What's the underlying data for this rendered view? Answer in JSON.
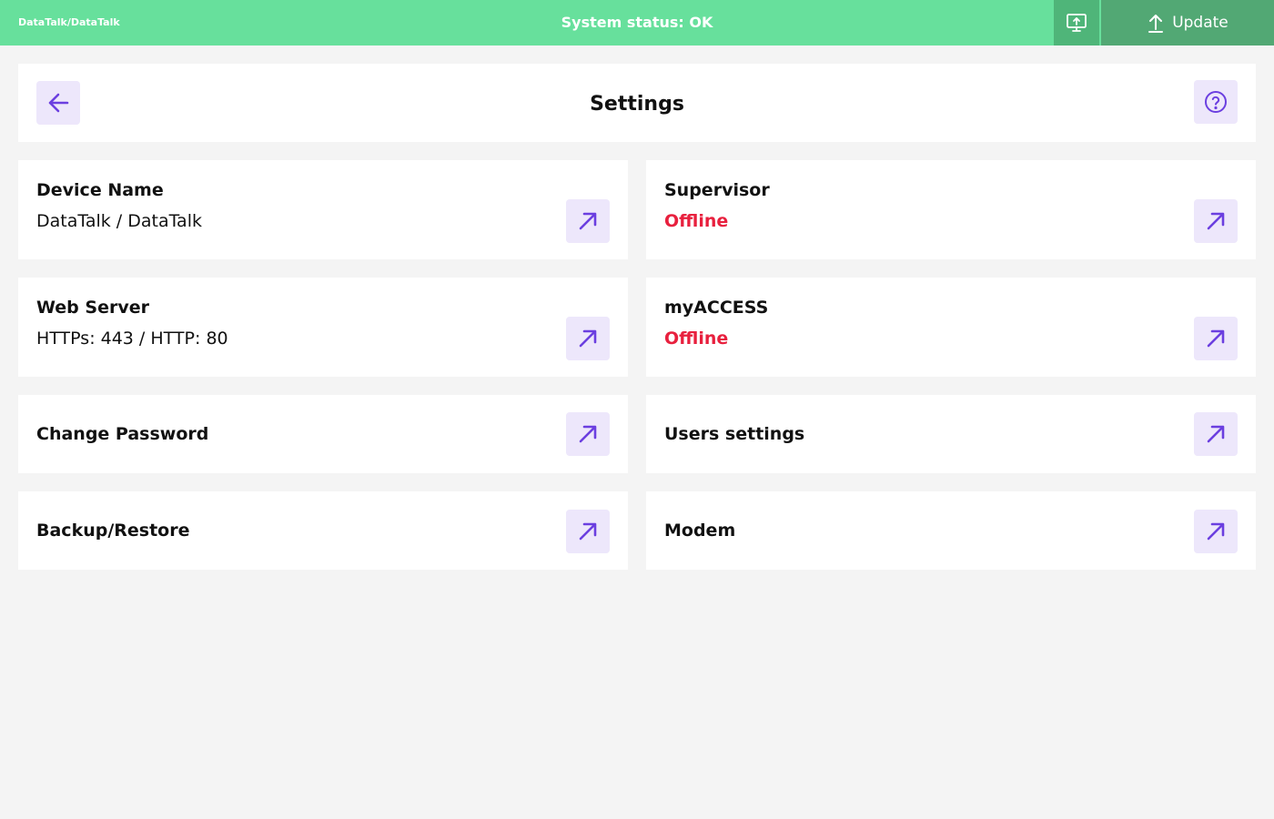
{
  "topbar": {
    "device_label": "DataTalk/DataTalk",
    "system_status": "System status: OK",
    "update_label": "Update"
  },
  "header": {
    "title": "Settings"
  },
  "cards": [
    {
      "title": "Device Name",
      "subtitle": "DataTalk / DataTalk"
    },
    {
      "title": "Supervisor",
      "subtitle": "Offline"
    },
    {
      "title": "Web Server",
      "subtitle": "HTTPs: 443 / HTTP: 80"
    },
    {
      "title": "myACCESS",
      "subtitle": "Offline"
    },
    {
      "title": "Change Password"
    },
    {
      "title": "Users settings"
    },
    {
      "title": "Backup/Restore"
    },
    {
      "title": "Modem"
    }
  ],
  "colors": {
    "topbar": "#67e09c",
    "accent": "#6b3fe0",
    "button_bg": "#ede7fb",
    "offline": "#e8203e"
  },
  "icons": {
    "back": "arrow-left-icon",
    "help": "question-circle-icon",
    "monitor": "monitor-upload-icon",
    "update": "upload-arrow-icon",
    "open": "arrow-up-right-icon"
  }
}
